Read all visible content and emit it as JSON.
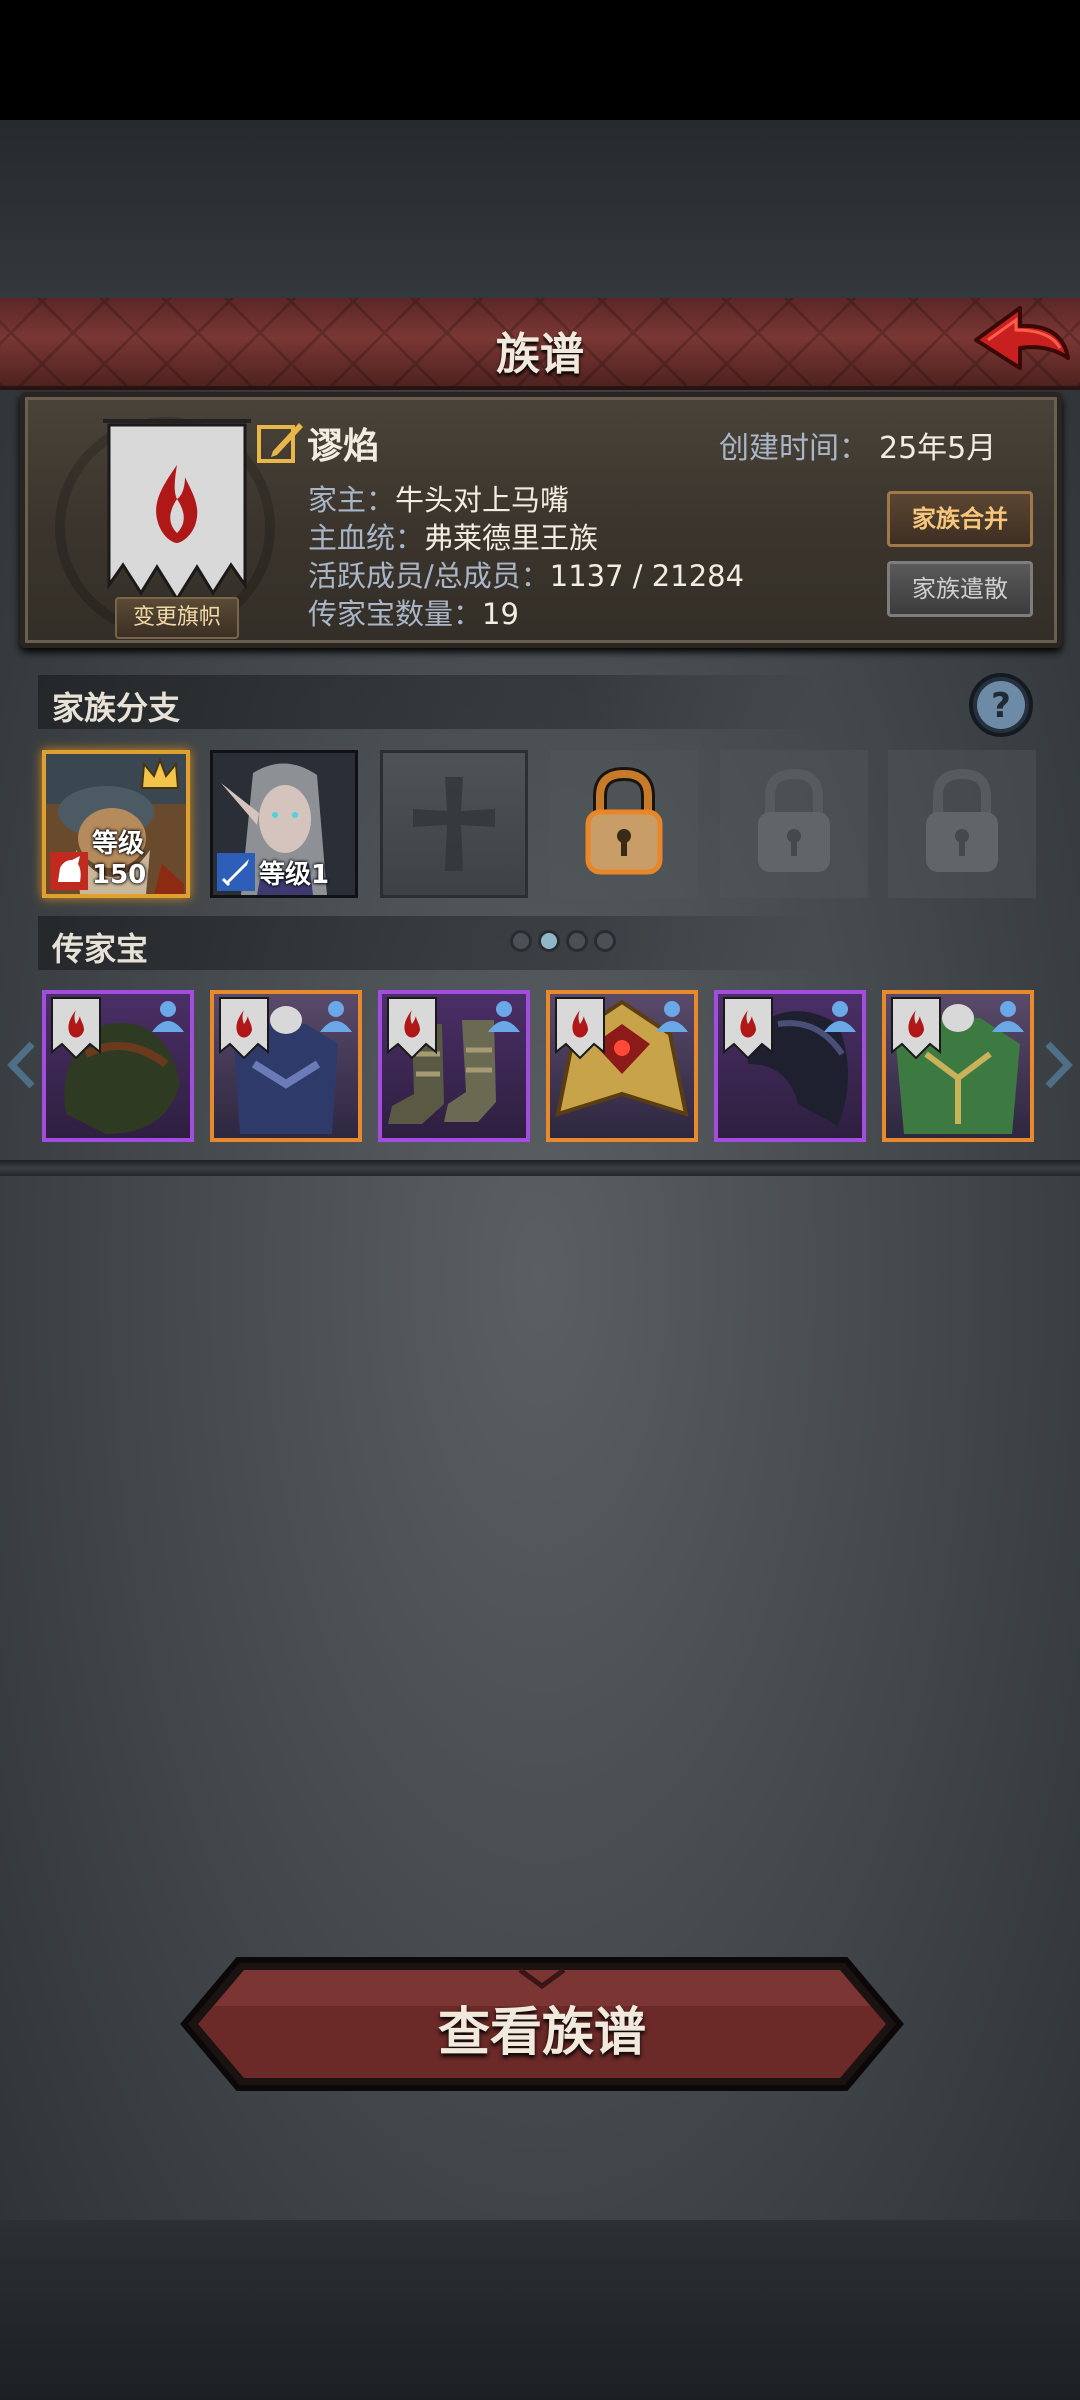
{
  "header": {
    "title": "族谱"
  },
  "family": {
    "name": "谬焰",
    "created_label": "创建时间：",
    "created_value": "25年5月",
    "rows": [
      {
        "key": "家主：",
        "value": "牛头对上马嘴"
      },
      {
        "key": "主血统：",
        "value": "弗莱德里王族"
      },
      {
        "key": "活跃成员/总成员：",
        "value": "1137 / 21284"
      },
      {
        "key": "传家宝数量：",
        "value": "19"
      }
    ],
    "change_flag_label": "变更旗帜",
    "merge_label": "家族合并",
    "disband_label": "家族遣散"
  },
  "branches": {
    "title": "家族分支",
    "members": [
      {
        "level": "等级150",
        "icon": "cavalry-icon",
        "portrait": "bearded-warrior"
      },
      {
        "level": "等级1",
        "icon": "sword-icon",
        "portrait": "elf-woman"
      }
    ],
    "empty_slots": [
      "cross-icon",
      "lock-open-icon",
      "lock-icon",
      "lock-icon"
    ]
  },
  "treasures": {
    "title": "传家宝",
    "page_dots": 4,
    "active_page": 2,
    "items": [
      {
        "name": "hood",
        "rarity": "purple"
      },
      {
        "name": "armor",
        "rarity": "orange"
      },
      {
        "name": "boots",
        "rarity": "purple"
      },
      {
        "name": "ornate-shield",
        "rarity": "orange"
      },
      {
        "name": "dark-helmet",
        "rarity": "purple"
      },
      {
        "name": "green-armor",
        "rarity": "orange"
      }
    ],
    "colors": {
      "purple": "#a24de0",
      "orange": "#e88a2c"
    }
  },
  "action": {
    "view_tree_label": "查看族谱"
  }
}
